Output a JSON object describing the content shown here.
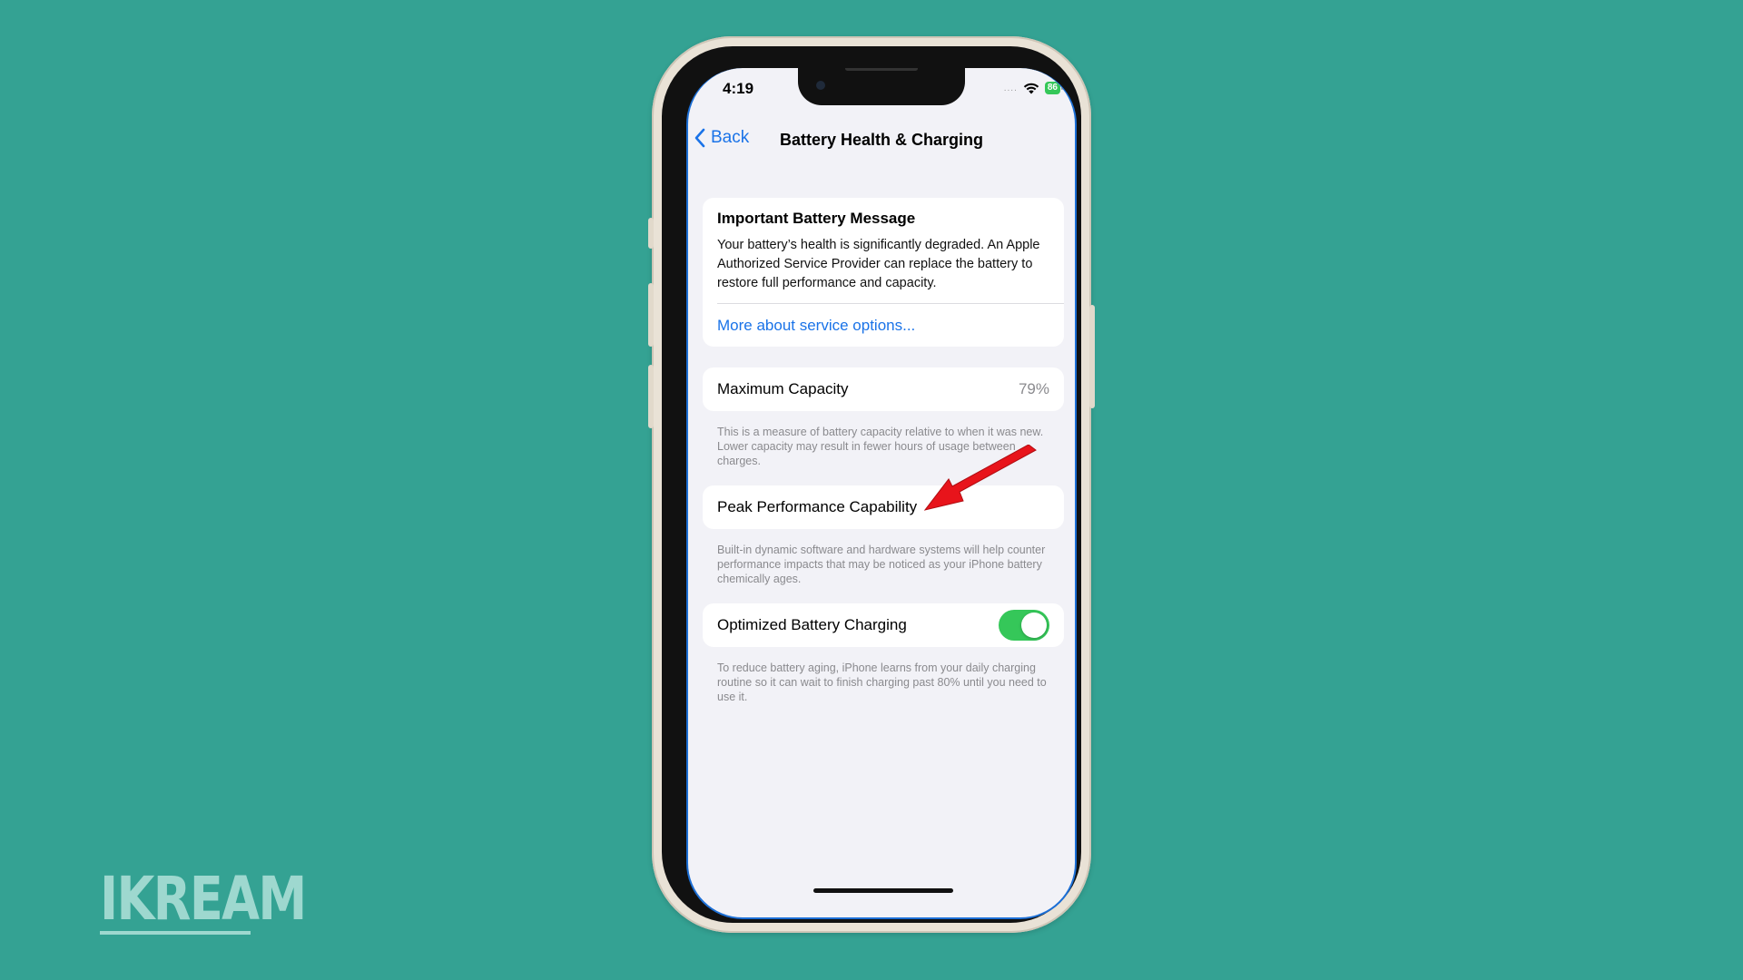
{
  "status_bar": {
    "time": "4:19",
    "signal": "....",
    "battery": "86"
  },
  "nav": {
    "back_label": "Back",
    "title": "Battery Health & Charging"
  },
  "message": {
    "title": "Important Battery Message",
    "body": "Your battery’s health is significantly degraded. An Apple Authorized Service Provider can replace the battery to restore full performance and capacity.",
    "link": "More about service options..."
  },
  "capacity": {
    "label": "Maximum Capacity",
    "value": "79%",
    "footnote": "This is a measure of battery capacity relative to when it was new. Lower capacity may result in fewer hours of usage between charges."
  },
  "performance": {
    "label": "Peak Performance Capability",
    "footnote": "Built-in dynamic software and hardware systems will help counter performance impacts that may be noticed as your iPhone battery chemically ages."
  },
  "charging": {
    "label": "Optimized Battery Charging",
    "enabled": true,
    "footnote": "To reduce battery aging, iPhone learns from your daily charging routine so it can wait to finish charging past 80% until you need to use it."
  },
  "watermark": "IKREAM",
  "colors": {
    "background": "#34a293",
    "accent": "#1a73e8",
    "toggle_on": "#35c759",
    "arrow": "#e8141b"
  }
}
